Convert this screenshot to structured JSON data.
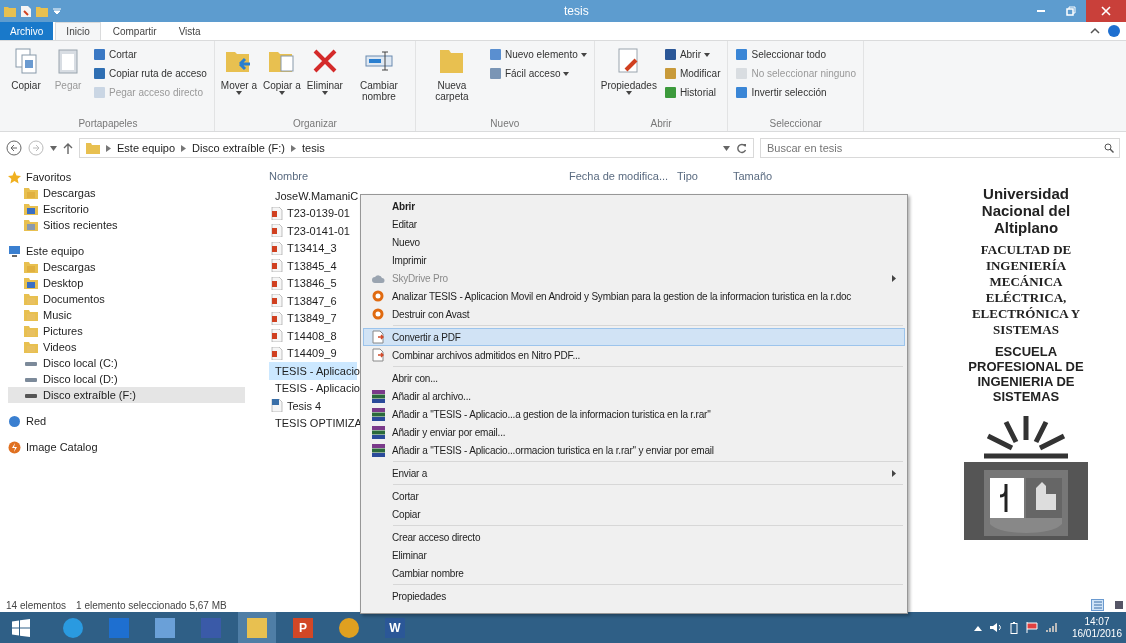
{
  "window": {
    "title": "tesis"
  },
  "ribbon_tabs": [
    {
      "label": "Archivo",
      "kind": "file",
      "selected": false
    },
    {
      "label": "Inicio",
      "kind": "tab",
      "selected": true
    },
    {
      "label": "Compartir",
      "kind": "tab",
      "selected": false
    },
    {
      "label": "Vista",
      "kind": "tab",
      "selected": false
    }
  ],
  "ribbon_groups": [
    {
      "label": "Portapapeles",
      "big": [
        {
          "label": "Copiar",
          "kind": "copy",
          "disabled": false,
          "dropdown": false
        },
        {
          "label": "Pegar",
          "kind": "paste",
          "disabled": true,
          "dropdown": false
        }
      ],
      "small": [
        {
          "label": "Cortar",
          "kind": "scissors",
          "disabled": false,
          "dropdown": false
        },
        {
          "label": "Copiar ruta de acceso",
          "kind": "path",
          "disabled": false,
          "dropdown": false
        },
        {
          "label": "Pegar acceso directo",
          "kind": "shortcut",
          "disabled": true,
          "dropdown": false
        }
      ]
    },
    {
      "label": "Organizar",
      "big": [
        {
          "label": "Mover a",
          "kind": "move",
          "disabled": false,
          "dropdown": true
        },
        {
          "label": "Copiar a",
          "kind": "copyto",
          "disabled": false,
          "dropdown": true
        },
        {
          "label": "Eliminar",
          "kind": "delete",
          "disabled": false,
          "dropdown": true
        },
        {
          "label": "Cambiar nombre",
          "kind": "rename",
          "disabled": false,
          "dropdown": false
        }
      ]
    },
    {
      "label": "Nuevo",
      "big": [
        {
          "label": "Nueva carpeta",
          "kind": "folder",
          "disabled": false,
          "dropdown": false
        }
      ],
      "small": [
        {
          "label": "Nuevo elemento",
          "kind": "newitem",
          "disabled": false,
          "dropdown": true
        },
        {
          "label": "Fácil acceso",
          "kind": "easy",
          "disabled": false,
          "dropdown": true
        }
      ]
    },
    {
      "label": "Abrir",
      "big": [
        {
          "label": "Propiedades",
          "kind": "properties",
          "disabled": false,
          "dropdown": true
        }
      ],
      "small": [
        {
          "label": "Abrir",
          "kind": "word",
          "disabled": false,
          "dropdown": true
        },
        {
          "label": "Modificar",
          "kind": "edit",
          "disabled": false,
          "dropdown": false
        },
        {
          "label": "Historial",
          "kind": "history",
          "disabled": false,
          "dropdown": false
        }
      ]
    },
    {
      "label": "Seleccionar",
      "small": [
        {
          "label": "Seleccionar todo",
          "kind": "selall",
          "disabled": false,
          "dropdown": false
        },
        {
          "label": "No seleccionar ninguno",
          "kind": "selnone",
          "disabled": true,
          "dropdown": false
        },
        {
          "label": "Invertir selección",
          "kind": "selinv",
          "disabled": false,
          "dropdown": false
        }
      ]
    }
  ],
  "address": {
    "crumbs": [
      "Este equipo",
      "Disco extraíble (F:)",
      "tesis"
    ],
    "search_placeholder": "Buscar en tesis"
  },
  "sidebar": {
    "groups": [
      {
        "label": "Favoritos",
        "kind": "star",
        "children": [
          {
            "label": "Descargas",
            "kind": "download",
            "selected": false
          },
          {
            "label": "Escritorio",
            "kind": "desktop",
            "selected": false
          },
          {
            "label": "Sitios recientes",
            "kind": "recent",
            "selected": false
          }
        ]
      },
      {
        "label": "Este equipo",
        "kind": "pc",
        "children": [
          {
            "label": "Descargas",
            "kind": "download",
            "selected": false
          },
          {
            "label": "Desktop",
            "kind": "desktop",
            "selected": false
          },
          {
            "label": "Documentos",
            "kind": "folder",
            "selected": false
          },
          {
            "label": "Music",
            "kind": "folder",
            "selected": false
          },
          {
            "label": "Pictures",
            "kind": "folder",
            "selected": false
          },
          {
            "label": "Videos",
            "kind": "folder",
            "selected": false
          },
          {
            "label": "Disco local (C:)",
            "kind": "drive",
            "selected": false
          },
          {
            "label": "Disco local (D:)",
            "kind": "drive",
            "selected": false
          },
          {
            "label": "Disco extraíble (F:)",
            "kind": "usb",
            "selected": true
          }
        ]
      },
      {
        "label": "Red",
        "kind": "network"
      },
      {
        "label": "Image Catalog",
        "kind": "catalog"
      }
    ]
  },
  "table": {
    "columns": [
      "Nombre",
      "Fecha de modifica...",
      "Tipo",
      "Tamaño"
    ],
    "rows": [
      {
        "name": "JoseW.MamaniC",
        "kind": "doc",
        "selected": false
      },
      {
        "name": "T23-0139-01",
        "kind": "pdf",
        "selected": false
      },
      {
        "name": "T23-0141-01",
        "kind": "pdf",
        "selected": false
      },
      {
        "name": "T13414_3",
        "kind": "pdf",
        "selected": false
      },
      {
        "name": "T13845_4",
        "kind": "pdf",
        "selected": false
      },
      {
        "name": "T13846_5",
        "kind": "pdf",
        "selected": false
      },
      {
        "name": "T13847_6",
        "kind": "pdf",
        "selected": false
      },
      {
        "name": "T13849_7",
        "kind": "pdf",
        "selected": false
      },
      {
        "name": "T14408_8",
        "kind": "pdf",
        "selected": false
      },
      {
        "name": "T14409_9",
        "kind": "pdf",
        "selected": false
      },
      {
        "name": "TESIS - Aplicacio",
        "kind": "doc",
        "selected": true
      },
      {
        "name": "TESIS - Aplicacio",
        "kind": "pdf",
        "selected": false
      },
      {
        "name": "Tesis 4",
        "kind": "olddoc",
        "selected": false
      },
      {
        "name": "TESIS OPTIMIZA",
        "kind": "olddoc",
        "selected": false
      }
    ]
  },
  "context_menu": {
    "groups": [
      [
        {
          "label": "Abrir",
          "kind": "plain",
          "default": true,
          "disabled": false,
          "submenu": false,
          "selected": false
        },
        {
          "label": "Editar",
          "kind": "plain",
          "default": false,
          "disabled": false,
          "submenu": false,
          "selected": false
        },
        {
          "label": "Nuevo",
          "kind": "plain",
          "default": false,
          "disabled": false,
          "submenu": false,
          "selected": false
        },
        {
          "label": "Imprimir",
          "kind": "plain",
          "default": false,
          "disabled": false,
          "submenu": false,
          "selected": false
        },
        {
          "label": "SkyDrive Pro",
          "kind": "cloud",
          "default": false,
          "disabled": true,
          "submenu": true,
          "selected": false
        },
        {
          "label": "Analizar TESIS - Aplicacion Movil en Android y Symbian para la gestion de la informacion turistica en la r.doc",
          "kind": "avast",
          "default": false,
          "disabled": false,
          "submenu": false,
          "selected": false
        },
        {
          "label": "Destruir con Avast",
          "kind": "avast",
          "default": false,
          "disabled": false,
          "submenu": false,
          "selected": false
        }
      ],
      [
        {
          "label": "Convertir a PDF",
          "kind": "nitro",
          "default": false,
          "disabled": false,
          "submenu": false,
          "selected": true
        },
        {
          "label": "Combinar archivos admitidos en Nitro PDF...",
          "kind": "nitro",
          "default": false,
          "disabled": false,
          "submenu": false,
          "selected": false
        }
      ],
      [
        {
          "label": "Abrir con...",
          "kind": "plain",
          "default": false,
          "disabled": false,
          "submenu": false,
          "selected": false
        },
        {
          "label": "Añadir al archivo...",
          "kind": "rar",
          "default": false,
          "disabled": false,
          "submenu": false,
          "selected": false
        },
        {
          "label": "Añadir a \"TESIS - Aplicacio...a gestion de la informacion turistica en la r.rar\"",
          "kind": "rar",
          "default": false,
          "disabled": false,
          "submenu": false,
          "selected": false
        },
        {
          "label": "Añadir y enviar por email...",
          "kind": "rar",
          "default": false,
          "disabled": false,
          "submenu": false,
          "selected": false
        },
        {
          "label": "Añadir a \"TESIS - Aplicacio...ormacion turistica en la r.rar\" y enviar por email",
          "kind": "rar",
          "default": false,
          "disabled": false,
          "submenu": false,
          "selected": false
        }
      ],
      [
        {
          "label": "Enviar a",
          "kind": "plain",
          "default": false,
          "disabled": false,
          "submenu": true,
          "selected": false
        }
      ],
      [
        {
          "label": "Cortar",
          "kind": "plain",
          "default": false,
          "disabled": false,
          "submenu": false,
          "selected": false
        },
        {
          "label": "Copiar",
          "kind": "plain",
          "default": false,
          "disabled": false,
          "submenu": false,
          "selected": false
        }
      ],
      [
        {
          "label": "Crear acceso directo",
          "kind": "plain",
          "default": false,
          "disabled": false,
          "submenu": false,
          "selected": false
        },
        {
          "label": "Eliminar",
          "kind": "plain",
          "default": false,
          "disabled": false,
          "submenu": false,
          "selected": false
        },
        {
          "label": "Cambiar nombre",
          "kind": "plain",
          "default": false,
          "disabled": false,
          "submenu": false,
          "selected": false
        }
      ],
      [
        {
          "label": "Propiedades",
          "kind": "plain",
          "default": false,
          "disabled": false,
          "submenu": false,
          "selected": false
        }
      ]
    ]
  },
  "preview": {
    "blocks": [
      {
        "kind": "sans",
        "lines": [
          "Universidad",
          "Nacional del",
          "Altiplano"
        ]
      },
      {
        "kind": "serif",
        "lines": [
          "FACULTAD DE",
          "INGENIERÍA",
          "MECÁNICA",
          "ELÉCTRICA,",
          "ELECTRÓNICA Y",
          "SISTEMAS"
        ]
      },
      {
        "kind": "sanscaps",
        "lines": [
          "ESCUELA",
          "PROFESIONAL DE",
          "INGENIERIA DE",
          "SISTEMAS"
        ]
      }
    ]
  },
  "status_bar": {
    "count": "14 elementos",
    "selection": "1 elemento seleccionado  5,67 MB"
  },
  "taskbar": {
    "apps": [
      {
        "kind": "ie",
        "active": false
      },
      {
        "kind": "blue",
        "active": false
      },
      {
        "kind": "tool",
        "active": false
      },
      {
        "kind": "mail",
        "active": false
      },
      {
        "kind": "explorer",
        "active": true
      },
      {
        "kind": "ppt",
        "label": "P",
        "active": false
      },
      {
        "kind": "chrome",
        "active": false
      },
      {
        "kind": "word",
        "label": "W",
        "active": false
      }
    ],
    "time": "14:07",
    "date": "16/01/2016"
  }
}
